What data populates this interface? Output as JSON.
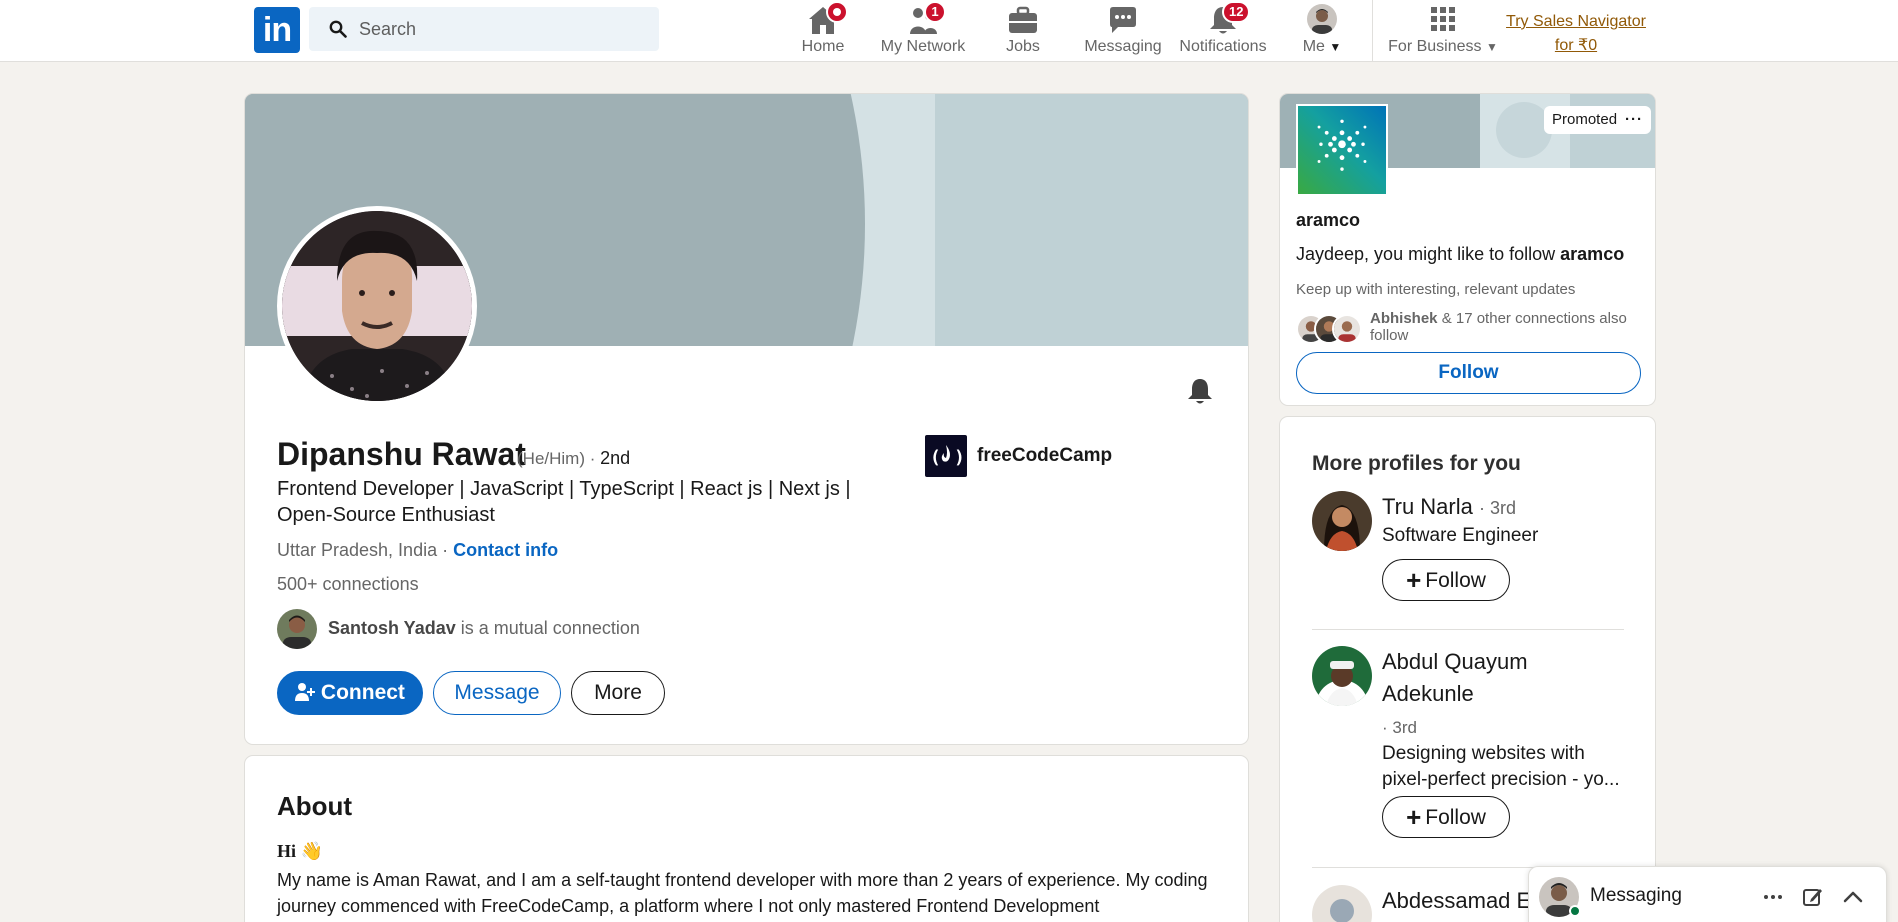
{
  "nav": {
    "search_placeholder": "Search",
    "items": [
      {
        "label": "Home",
        "badge": ""
      },
      {
        "label": "My Network",
        "badge": "1"
      },
      {
        "label": "Jobs",
        "badge": ""
      },
      {
        "label": "Messaging",
        "badge": ""
      },
      {
        "label": "Notifications",
        "badge": "12"
      }
    ],
    "me_label": "Me",
    "business_label": "For Business",
    "sales_link": "Try Sales Navigator for ₹0",
    "logo_text": "in"
  },
  "profile": {
    "name": "Dipanshu Rawat",
    "pronouns": "(He/Him) ·",
    "degree": "2nd",
    "headline": "Frontend Developer | JavaScript | TypeScript | React js | Next js | Open-Source Enthusiast",
    "location": "Uttar Pradesh, India ·",
    "contact_info": "Contact info",
    "connections": "500+ connections",
    "mutual_name": "Santosh Yadav",
    "mutual_suffix": "is a mutual connection",
    "company": "freeCodeCamp",
    "buttons": {
      "connect": "Connect",
      "message": "Message",
      "more": "More"
    }
  },
  "about": {
    "title": "About",
    "greeting": "Hi 👋",
    "text": "My name is Aman Rawat, and I am a self-taught frontend developer with more than 2 years of experience. My coding journey commenced with FreeCodeCamp, a platform where I not only mastered Frontend Development"
  },
  "ad": {
    "promoted": "Promoted",
    "promoted_menu": "···",
    "company": "aramco",
    "follow_prefix": "Jaydeep, you might like to follow",
    "follow_company": "aramco",
    "subtitle": "Keep up with interesting, relevant updates",
    "conn_name": "Abhishek",
    "conn_suffix": "& 17 other connections also follow",
    "follow_button": "Follow"
  },
  "more_profiles": {
    "title": "More profiles for you",
    "people": [
      {
        "name": "Tru Narla",
        "degree": "· 3rd",
        "title": "Software Engineer",
        "follow": "Follow"
      },
      {
        "name": "Abdul Quayum Adekunle",
        "degree": "· 3rd",
        "title": "Designing websites with pixel-perfect precision - yo...",
        "follow": "Follow"
      },
      {
        "name": "Abdessamad El",
        "degree": "",
        "title": "",
        "follow": ""
      }
    ]
  },
  "messaging": {
    "label": "Messaging"
  },
  "colors": {
    "brand": "#0a66c2",
    "badge": "#cb112d",
    "premium_link": "#915907",
    "online": "#057642"
  }
}
